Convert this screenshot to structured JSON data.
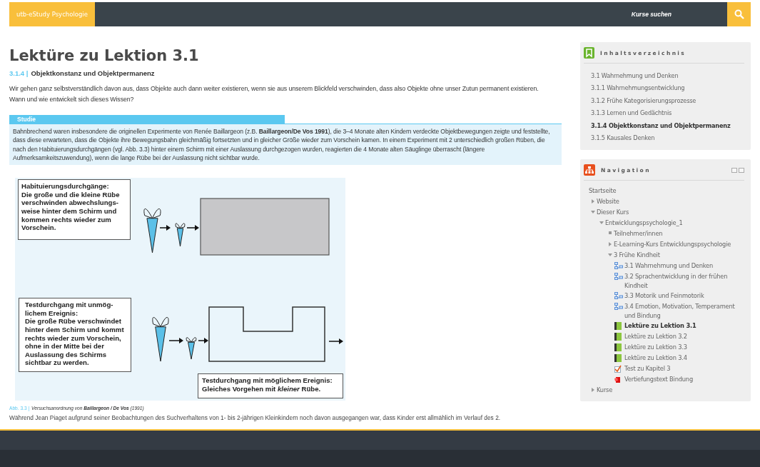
{
  "topbar": {
    "brand": "utb-eStudy Psychologie",
    "search_label": "Kurse suchen"
  },
  "main": {
    "title": "Lektüre zu Lektion 3.1",
    "section_number": "3.1.4 |",
    "section_title": "Objektkonstanz und Objektpermanenz",
    "intro": [
      "Wir gehen ganz selbstverständlich davon aus, dass Objekte auch dann weiter existieren, wenn sie aus unserem Blickfeld verschwinden, dass also Objekte ohne unser Zutun permanent existieren.",
      "Wann und wie entwickelt sich dieses Wissen?"
    ],
    "study": {
      "label": "Studie",
      "text": "Bahnbrechend waren insbesondere die originellen Experimente von Renée Baillargeon (z.B. **Baillargeon/De Vos 1991**), die 3–4 Monate alten Kindern verdeckte Objektbewegungen zeigte und feststellte, dass diese erwarteten, dass die Objekte ihre Bewegungsbahn gleichmäßig fortsetzten und in gleicher Größe wieder zum Vorschein kamen. In einem Experiment mit 2 unterschiedlich großen Rüben, die nach den Habituierungsdurchgängen (vgl. Abb. 3.3) hinter einem Schirm mit einer Auslassung durchgezogen wurden, reagierten die 4 Monate alten Säuglinge überrascht (längere Aufmerksamkeitszuwendung), wenn die lange Rübe bei der Auslassung nicht sichtbar wurde."
    },
    "figure": {
      "boxes": [
        {
          "lines": [
            "Habituierungsdurchgänge:",
            "Die große und die kleine Rübe",
            "verschwinden abwechslungs-",
            "weise hinter dem Schirm und",
            "kommen rechts wieder zum",
            "Vorschein."
          ]
        },
        {
          "lines": [
            "Testdurchgang mit unmög-",
            "lichem Ereignis:",
            "Die große Rübe verschwindet",
            "hinter dem Schirm und kommt",
            "rechts wieder zum Vorschein,",
            "ohne in der Mitte bei der",
            "Auslassung des Schirms",
            "sichtbar zu werden."
          ]
        },
        {
          "lines": [
            "Testdurchgang mit möglichem Ereignis:",
            "Gleiches Vorgehen mit *kleiner* Rübe."
          ]
        }
      ]
    },
    "caption": {
      "number": "Abb. 3.3 |",
      "text": "Versuchsanordnung von **Baillargeon / De Vos** (1991)"
    },
    "continued_text": "Während Jean Piaget aufgrund seiner Beobachtungen des Suchverhaltens von 1- bis 2-jährigen Kleinkindern noch davon ausgegangen war, dass Kinder erst allmählich im Verlauf des 2."
  },
  "toc": {
    "title": "Inhaltsverzeichnis",
    "items": [
      {
        "label": "3.1 Wahrnehmung und Denken",
        "selected": false
      },
      {
        "label": "3.1.1 Wahrnehmungsentwicklung",
        "selected": false
      },
      {
        "label": "3.1.2 Frühe Kategorisierungsprozesse",
        "selected": false
      },
      {
        "label": "3.1.3 Lernen und Gedächtnis",
        "selected": false
      },
      {
        "label": "3.1.4 Objektkonstanz und Objektpermanenz",
        "selected": true
      },
      {
        "label": "3.1.5 Kausales Denken",
        "selected": false
      }
    ]
  },
  "navigation": {
    "title": "Navigation",
    "items": [
      {
        "label": "Startseite",
        "kind": "leaf"
      },
      {
        "label": "Website",
        "kind": "branch",
        "expanded": false
      },
      {
        "label": "Dieser Kurs",
        "kind": "branch",
        "expanded": true,
        "children": [
          {
            "label": "Entwicklungspsychologie_1",
            "kind": "branch",
            "expanded": true,
            "children": [
              {
                "label": "Teilnehmer/innen",
                "kind": "bullet"
              },
              {
                "label": "E-Learning-Kurs Entwicklungspsychologie",
                "kind": "branch",
                "expanded": false
              },
              {
                "label": "3 Frühe Kindheit",
                "kind": "branch",
                "expanded": true,
                "children": [
                  {
                    "label": "3.1 Wahrnehmung und Denken",
                    "kind": "section",
                    "selected": false
                  },
                  {
                    "label": "3.2 Sprachentwicklung in der frühen Kindheit",
                    "kind": "section",
                    "selected": false
                  },
                  {
                    "label": "3.3 Motorik und Feinmotorik",
                    "kind": "section",
                    "selected": false
                  },
                  {
                    "label": "3.4 Emotion, Motivation, Temperament und Bindung",
                    "kind": "section",
                    "selected": false
                  },
                  {
                    "label": "Lektüre zu Lektion 3.1",
                    "kind": "book",
                    "selected": true
                  },
                  {
                    "label": "Lektüre zu Lektion 3.2",
                    "kind": "book",
                    "selected": false
                  },
                  {
                    "label": "Lektüre zu Lektion 3.3",
                    "kind": "book",
                    "selected": false
                  },
                  {
                    "label": "Lektüre zu Lektion 3.4",
                    "kind": "book",
                    "selected": false
                  },
                  {
                    "label": "Test zu Kapitel 3",
                    "kind": "quiz",
                    "selected": false
                  },
                  {
                    "label": "Vertiefungstext Bindung",
                    "kind": "file",
                    "selected": false
                  }
                ]
              }
            ]
          }
        ]
      },
      {
        "label": "Kurse",
        "kind": "branch",
        "expanded": false
      }
    ]
  }
}
